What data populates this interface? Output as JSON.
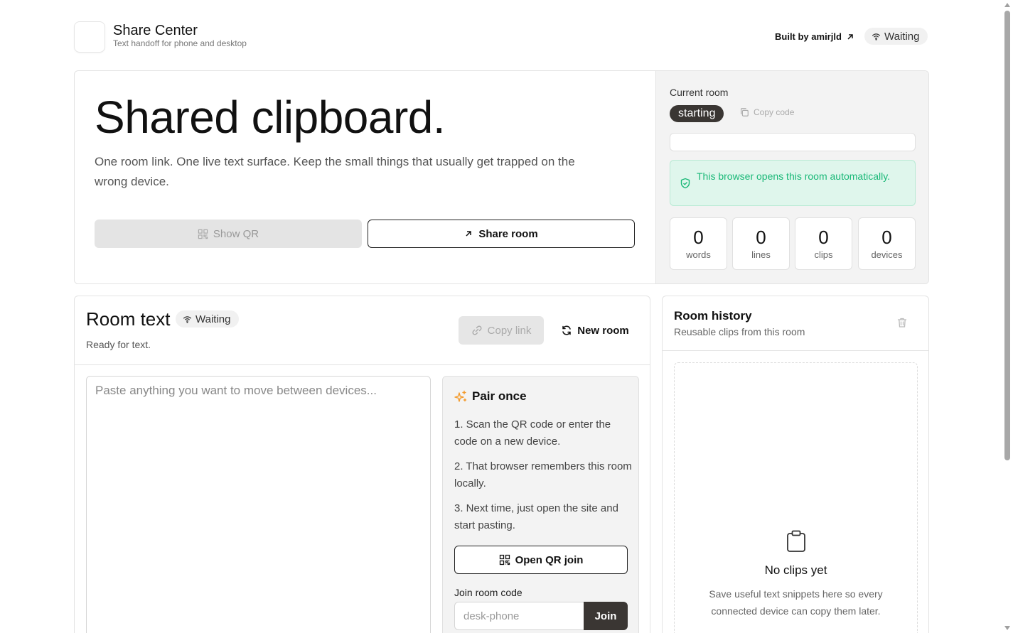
{
  "header": {
    "brand_title": "Share Center",
    "brand_subtitle": "Text handoff for phone and desktop",
    "built_by": "Built by amirjld",
    "status": "Waiting"
  },
  "hero": {
    "title": "Shared clipboard.",
    "description": "One room link. One live text surface. Keep the small things that usually get trapped on the wrong device.",
    "show_qr_label": "Show QR",
    "share_room_label": "Share room"
  },
  "current_room": {
    "label": "Current room",
    "room_code": "starting",
    "copy_code_label": "Copy code",
    "link_value": "",
    "auto_open_text": "This browser opens this room automatically.",
    "stats": [
      {
        "value": "0",
        "label": "words"
      },
      {
        "value": "0",
        "label": "lines"
      },
      {
        "value": "0",
        "label": "clips"
      },
      {
        "value": "0",
        "label": "devices"
      }
    ]
  },
  "room_text": {
    "title": "Room text",
    "status": "Waiting",
    "subtitle": "Ready for text.",
    "copy_link_label": "Copy link",
    "new_room_label": "New room",
    "textarea_placeholder": "Paste anything you want to move between devices...",
    "textarea_value": ""
  },
  "pair": {
    "title": "Pair once",
    "steps": [
      "1. Scan the QR code or enter the code on a new device.",
      "2. That browser remembers this room locally.",
      "3. Next time, just open the site and start pasting."
    ],
    "open_qr_label": "Open QR join",
    "join_label": "Join room code",
    "join_placeholder": "desk-phone",
    "join_value": "",
    "join_button": "Join"
  },
  "history": {
    "title": "Room history",
    "subtitle": "Reusable clips from this room",
    "empty_title": "No clips yet",
    "empty_description": "Save useful text snippets here so every connected device can copy them later."
  },
  "icons": {
    "wifi": "wifi-icon",
    "arrow": "arrow-up-right-icon",
    "qr": "qr-code-icon",
    "copy": "copy-icon",
    "shield": "shield-check-icon",
    "link": "link-icon",
    "refresh": "refresh-icon",
    "sparkle": "sparkles-icon",
    "trash": "trash-icon",
    "clipboard": "clipboard-icon"
  },
  "colors": {
    "accent_dark": "#3a3633",
    "success_text": "#19b877",
    "success_bg": "#dff6ec",
    "sparkle": "#f39a2b"
  }
}
